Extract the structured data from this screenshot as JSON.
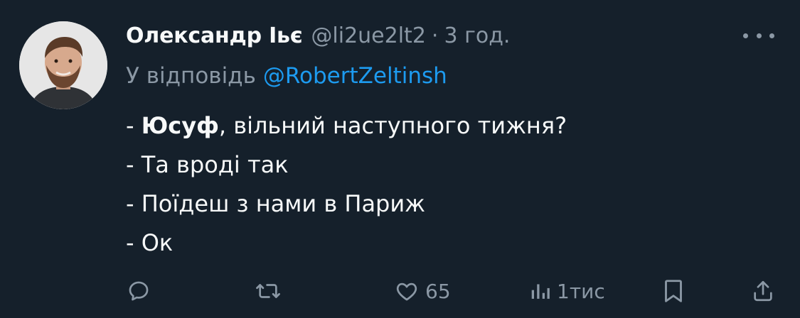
{
  "tweet": {
    "author": {
      "display_name": "Олександр Іьє",
      "handle": "@li2ue2lt2",
      "separator": "·",
      "time": "3 год."
    },
    "reply": {
      "prefix": "У відповідь",
      "mention": "@RobertZeltinsh"
    },
    "body": {
      "line1_dash": "- ",
      "line1_bold": "Юсуф",
      "line1_rest": ", вільний наступного тижня?",
      "line2": "- Та вроді так",
      "line3": "- Поїдеш з нами в Париж",
      "line4": "- Ок"
    },
    "actions": {
      "reply_icon": "reply-icon",
      "retweet_icon": "retweet-icon",
      "like_icon": "heart-icon",
      "like_count": "65",
      "views_icon": "views-icon",
      "views_count": "1тис",
      "bookmark_icon": "bookmark-icon",
      "share_icon": "share-icon"
    },
    "more_icon": "more-icon"
  },
  "colors": {
    "background": "#15202b",
    "text_primary": "#f7f9f9",
    "text_secondary": "#8b98a5",
    "accent": "#1d9bf0"
  }
}
